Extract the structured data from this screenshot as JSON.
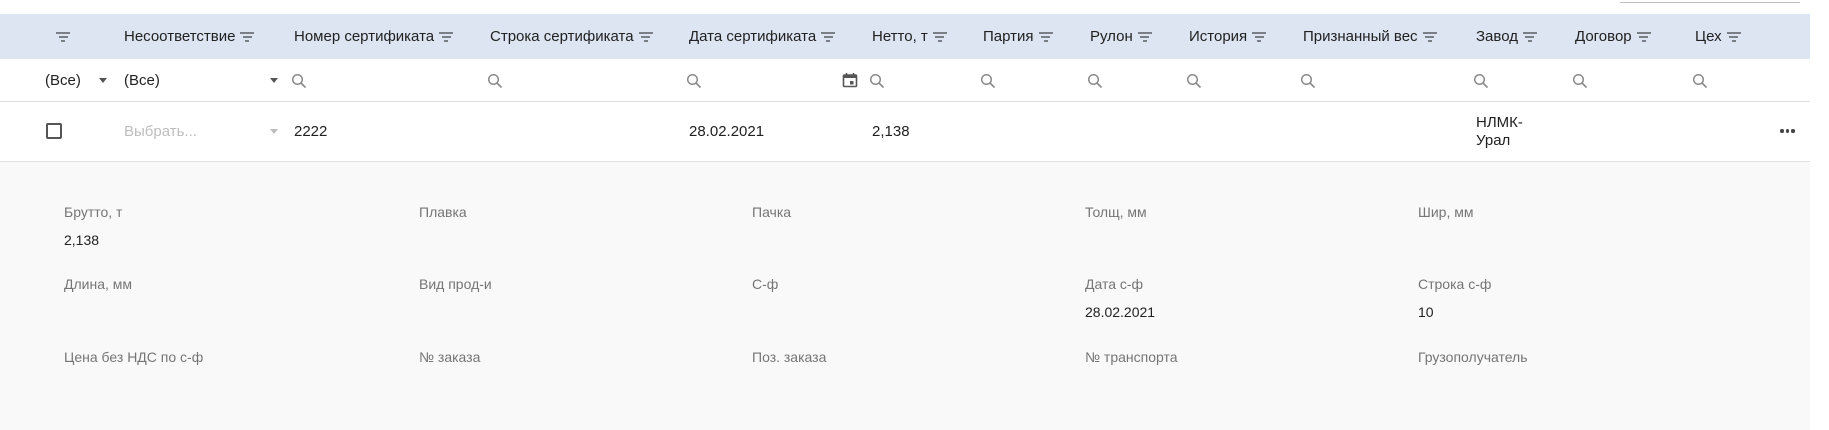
{
  "columns": [
    {
      "key": "filter",
      "label": ""
    },
    {
      "key": "nesootv",
      "label": "Несоответствие"
    },
    {
      "key": "cert_no",
      "label": "Номер сертификата"
    },
    {
      "key": "cert_line",
      "label": "Строка сертификата"
    },
    {
      "key": "cert_date",
      "label": "Дата сертификата"
    },
    {
      "key": "netto",
      "label": "Нетто, т"
    },
    {
      "key": "party",
      "label": "Партия"
    },
    {
      "key": "roll",
      "label": "Рулон"
    },
    {
      "key": "history",
      "label": "История"
    },
    {
      "key": "weight",
      "label": "Признанный вес"
    },
    {
      "key": "plant",
      "label": "Завод"
    },
    {
      "key": "contract",
      "label": "Договор"
    },
    {
      "key": "shop",
      "label": "Цех"
    }
  ],
  "filters": {
    "first_select": "(Все)",
    "nesootv_select": "(Все)"
  },
  "row": {
    "select_placeholder": "Выбрать...",
    "cert_no": "2222",
    "cert_date": "28.02.2021",
    "netto": "2,138",
    "plant_line1": "НЛМК-",
    "plant_line2": "Урал"
  },
  "detail": {
    "fields": [
      {
        "label": "Брутто, т",
        "value": "2,138"
      },
      {
        "label": "Плавка",
        "value": ""
      },
      {
        "label": "Пачка",
        "value": ""
      },
      {
        "label": "Толщ, мм",
        "value": ""
      },
      {
        "label": "Шир, мм",
        "value": ""
      },
      {
        "label": "Длина, мм",
        "value": ""
      },
      {
        "label": "Вид прод-и",
        "value": ""
      },
      {
        "label": "С-ф",
        "value": ""
      },
      {
        "label": "Дата с-ф",
        "value": "28.02.2021"
      },
      {
        "label": "Строка с-ф",
        "value": "10"
      },
      {
        "label": "Цена без НДС по с-ф",
        "value": ""
      },
      {
        "label": "№ заказа",
        "value": ""
      },
      {
        "label": "Поз. заказа",
        "value": ""
      },
      {
        "label": "№ транспорта",
        "value": ""
      },
      {
        "label": "Грузополучатель",
        "value": ""
      }
    ]
  },
  "icons": {
    "filter": "filter-icon",
    "search": "search-icon",
    "calendar": "calendar-icon",
    "caret": "chevron-down-icon",
    "more": "more-horizontal-icon"
  }
}
